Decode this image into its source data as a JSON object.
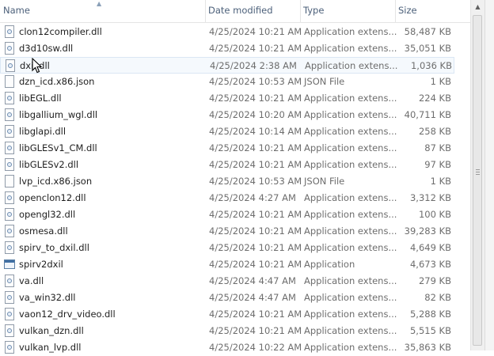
{
  "columns": {
    "name": "Name",
    "date": "Date modified",
    "type": "Type",
    "size": "Size"
  },
  "files": [
    {
      "name": "clon12compiler.dll",
      "date": "4/25/2024 10:21 AM",
      "type": "Application extens...",
      "size": "58,487 KB",
      "icon": "dll-file-icon"
    },
    {
      "name": "d3d10sw.dll",
      "date": "4/25/2024 10:21 AM",
      "type": "Application extens...",
      "size": "35,051 KB",
      "icon": "dll-file-icon"
    },
    {
      "name": "dxil.dll",
      "date": "4/25/2024 2:38 AM",
      "type": "Application extens...",
      "size": "1,036 KB",
      "icon": "dll-file-icon"
    },
    {
      "name": "dzn_icd.x86.json",
      "date": "4/25/2024 10:53 AM",
      "type": "JSON File",
      "size": "1 KB",
      "icon": "json-file-icon"
    },
    {
      "name": "libEGL.dll",
      "date": "4/25/2024 10:21 AM",
      "type": "Application extens...",
      "size": "224 KB",
      "icon": "dll-file-icon"
    },
    {
      "name": "libgallium_wgl.dll",
      "date": "4/25/2024 10:20 AM",
      "type": "Application extens...",
      "size": "40,711 KB",
      "icon": "dll-file-icon"
    },
    {
      "name": "libglapi.dll",
      "date": "4/25/2024 10:14 AM",
      "type": "Application extens...",
      "size": "258 KB",
      "icon": "dll-file-icon"
    },
    {
      "name": "libGLESv1_CM.dll",
      "date": "4/25/2024 10:21 AM",
      "type": "Application extens...",
      "size": "87 KB",
      "icon": "dll-file-icon"
    },
    {
      "name": "libGLESv2.dll",
      "date": "4/25/2024 10:21 AM",
      "type": "Application extens...",
      "size": "97 KB",
      "icon": "dll-file-icon"
    },
    {
      "name": "lvp_icd.x86.json",
      "date": "4/25/2024 10:53 AM",
      "type": "JSON File",
      "size": "1 KB",
      "icon": "json-file-icon"
    },
    {
      "name": "openclon12.dll",
      "date": "4/25/2024 4:27 AM",
      "type": "Application extens...",
      "size": "3,312 KB",
      "icon": "dll-file-icon"
    },
    {
      "name": "opengl32.dll",
      "date": "4/25/2024 10:21 AM",
      "type": "Application extens...",
      "size": "100 KB",
      "icon": "dll-file-icon"
    },
    {
      "name": "osmesa.dll",
      "date": "4/25/2024 10:21 AM",
      "type": "Application extens...",
      "size": "39,283 KB",
      "icon": "dll-file-icon"
    },
    {
      "name": "spirv_to_dxil.dll",
      "date": "4/25/2024 10:21 AM",
      "type": "Application extens...",
      "size": "4,649 KB",
      "icon": "dll-file-icon"
    },
    {
      "name": "spirv2dxil",
      "date": "4/25/2024 10:21 AM",
      "type": "Application",
      "size": "4,673 KB",
      "icon": "application-icon"
    },
    {
      "name": "va.dll",
      "date": "4/25/2024 4:47 AM",
      "type": "Application extens...",
      "size": "279 KB",
      "icon": "dll-file-icon"
    },
    {
      "name": "va_win32.dll",
      "date": "4/25/2024 4:47 AM",
      "type": "Application extens...",
      "size": "82 KB",
      "icon": "dll-file-icon"
    },
    {
      "name": "vaon12_drv_video.dll",
      "date": "4/25/2024 10:21 AM",
      "type": "Application extens...",
      "size": "5,288 KB",
      "icon": "dll-file-icon"
    },
    {
      "name": "vulkan_dzn.dll",
      "date": "4/25/2024 10:21 AM",
      "type": "Application extens...",
      "size": "5,515 KB",
      "icon": "dll-file-icon"
    },
    {
      "name": "vulkan_lvp.dll",
      "date": "4/25/2024 10:22 AM",
      "type": "Application extens...",
      "size": "35,863 KB",
      "icon": "dll-file-icon"
    }
  ],
  "hovered_row": 2,
  "colors": {
    "header_text": "#4c607a",
    "hover_bg": "#f5f9fd",
    "hover_border": "#dbe7f4",
    "detail_text": "#6d6d6d"
  }
}
